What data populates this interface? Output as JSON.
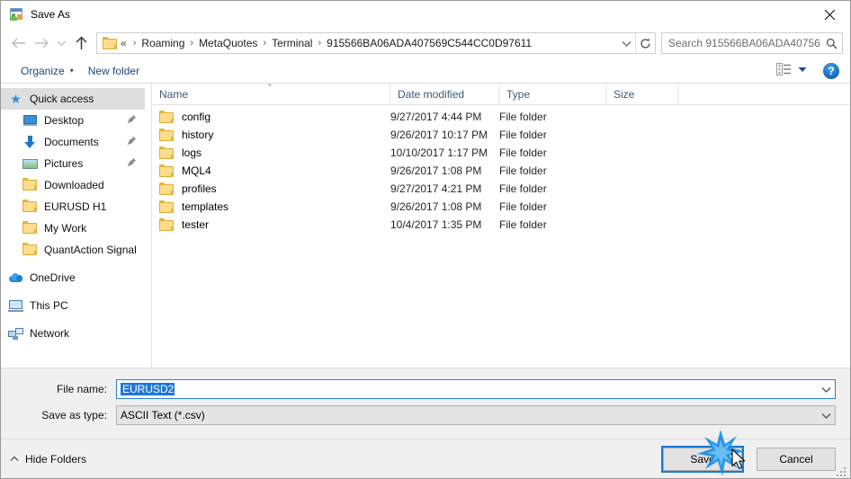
{
  "window": {
    "title": "Save As",
    "title_icon": "save-as-app-icon",
    "close_icon": "close-icon"
  },
  "nav": {
    "back_icon": "arrow-left-icon",
    "forward_icon": "arrow-right-icon",
    "recent_icon": "chevron-down-icon",
    "up_icon": "arrow-up-icon",
    "address_folder_icon": "folder-icon",
    "address_double_chevron": "«",
    "breadcrumbs": [
      "Roaming",
      "MetaQuotes",
      "Terminal",
      "915566BA06ADA407569C544CC0D97611"
    ],
    "breadcrumb_separator": "›",
    "address_dropdown_icon": "chevron-down-icon",
    "refresh_icon": "refresh-icon",
    "search_placeholder": "Search 915566BA06ADA40756...",
    "search_icon": "search-icon"
  },
  "toolbar": {
    "organize_label": "Organize",
    "organize_caret": "▾",
    "new_folder_label": "New folder",
    "view_icon": "view-details-icon",
    "view_caret": "▾",
    "help_label": "?",
    "help_icon": "help-icon"
  },
  "sidebar": {
    "items": [
      {
        "label": "Quick access",
        "icon": "star-icon",
        "selected": true,
        "indent": false,
        "pinned": false
      },
      {
        "label": "Desktop",
        "icon": "desktop-icon",
        "selected": false,
        "indent": true,
        "pinned": true
      },
      {
        "label": "Documents",
        "icon": "documents-icon",
        "selected": false,
        "indent": true,
        "pinned": true
      },
      {
        "label": "Pictures",
        "icon": "pictures-icon",
        "selected": false,
        "indent": true,
        "pinned": true
      },
      {
        "label": "Downloaded",
        "icon": "folder-icon",
        "selected": false,
        "indent": true,
        "pinned": false
      },
      {
        "label": "EURUSD H1",
        "icon": "folder-icon",
        "selected": false,
        "indent": true,
        "pinned": false
      },
      {
        "label": "My Work",
        "icon": "folder-icon",
        "selected": false,
        "indent": true,
        "pinned": false
      },
      {
        "label": "QuantAction Signal",
        "icon": "folder-icon",
        "selected": false,
        "indent": true,
        "pinned": false
      },
      {
        "label": "OneDrive",
        "icon": "cloud-icon",
        "selected": false,
        "indent": false,
        "pinned": false,
        "gap_before": true
      },
      {
        "label": "This PC",
        "icon": "this-pc-icon",
        "selected": false,
        "indent": false,
        "pinned": false,
        "gap_before": true
      },
      {
        "label": "Network",
        "icon": "network-icon",
        "selected": false,
        "indent": false,
        "pinned": false,
        "gap_before": true
      }
    ],
    "pin_glyph": "📌"
  },
  "filelist": {
    "columns": [
      "Name",
      "Date modified",
      "Type",
      "Size"
    ],
    "sort_indicator": "⌃",
    "rows": [
      {
        "name": "config",
        "date": "9/27/2017 4:44 PM",
        "type": "File folder",
        "size": ""
      },
      {
        "name": "history",
        "date": "9/26/2017 10:17 PM",
        "type": "File folder",
        "size": ""
      },
      {
        "name": "logs",
        "date": "10/10/2017 1:17 PM",
        "type": "File folder",
        "size": ""
      },
      {
        "name": "MQL4",
        "date": "9/26/2017 1:08 PM",
        "type": "File folder",
        "size": ""
      },
      {
        "name": "profiles",
        "date": "9/27/2017 4:21 PM",
        "type": "File folder",
        "size": ""
      },
      {
        "name": "templates",
        "date": "9/26/2017 1:08 PM",
        "type": "File folder",
        "size": ""
      },
      {
        "name": "tester",
        "date": "10/4/2017 1:35 PM",
        "type": "File folder",
        "size": ""
      }
    ]
  },
  "form": {
    "filename_label": "File name:",
    "filename_value": "EURUSD2",
    "filetype_label": "Save as type:",
    "filetype_value": "ASCII Text (*.csv)",
    "caret_icon": "chevron-down-icon"
  },
  "footer": {
    "hide_folders_label": "Hide Folders",
    "hide_folders_caret": "⌃",
    "save_label": "Save",
    "cancel_label": "Cancel",
    "resize_grip_icon": "resize-grip-icon",
    "click_burst_icon": "click-burst-icon",
    "cursor_icon": "mouse-cursor-icon"
  },
  "colors": {
    "accent": "#1a7ad4",
    "selection": "#1e78d7",
    "sidebar_selected": "#dedede",
    "chrome": "#f0f0f0",
    "header_text": "#3c5a78",
    "folder": "#fbdd8c",
    "burst": "#1e8fe8"
  }
}
